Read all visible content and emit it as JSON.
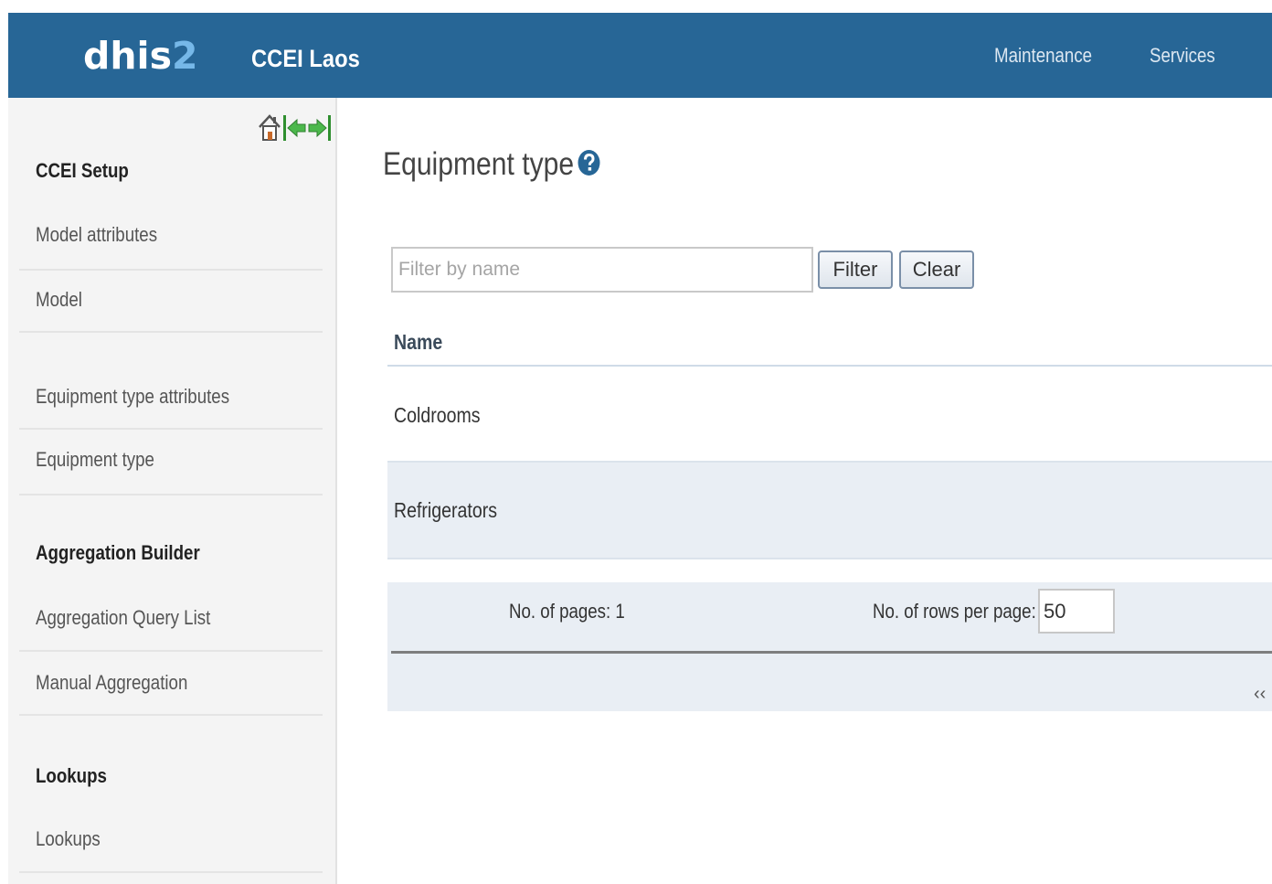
{
  "header": {
    "logo_main": "dhis",
    "logo_digit": "2",
    "instance_title": "CCEI Laos",
    "nav": [
      {
        "label": "Maintenance"
      },
      {
        "label": "Services"
      }
    ],
    "bar_color": "#276696"
  },
  "sidebar": {
    "controls": [
      "home-icon",
      "collapse-menu-icon",
      "expand-menu-icon"
    ],
    "sections": [
      {
        "header": "CCEI Setup",
        "items": [
          {
            "label": "Model attributes"
          },
          {
            "label": "Model"
          }
        ]
      },
      {
        "header": "",
        "items": [
          {
            "label": "Equipment type attributes"
          },
          {
            "label": "Equipment type"
          }
        ]
      },
      {
        "header": "Aggregation Builder",
        "items": [
          {
            "label": "Aggregation Query List"
          },
          {
            "label": "Manual Aggregation"
          }
        ]
      },
      {
        "header": "Lookups",
        "items": [
          {
            "label": "Lookups"
          }
        ]
      }
    ]
  },
  "main": {
    "title": "Equipment type",
    "help_icon": "question-circle-icon",
    "filter": {
      "placeholder": "Filter by name",
      "value": "",
      "filter_label": "Filter",
      "clear_label": "Clear"
    },
    "table": {
      "column": "Name",
      "rows": [
        "Coldrooms",
        "Refrigerators"
      ]
    },
    "pager": {
      "pages_text": "No. of pages: 1",
      "rows_label": "No. of rows per page:",
      "rows_value": "50",
      "first_glyph": "‹‹"
    }
  }
}
